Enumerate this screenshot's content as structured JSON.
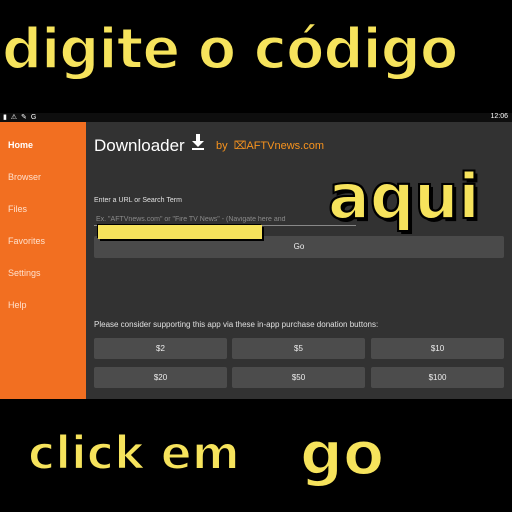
{
  "captions": {
    "top": "digite o código",
    "aqui": "aqui",
    "click": "click em",
    "go": "go"
  },
  "status_bar": {
    "icons": "▮ ⚠ ✎ G",
    "time": "12:06"
  },
  "sidebar": {
    "items": [
      {
        "label": "Home",
        "active": true
      },
      {
        "label": "Browser"
      },
      {
        "label": "Files"
      },
      {
        "label": "Favorites"
      },
      {
        "label": "Settings"
      },
      {
        "label": "Help"
      }
    ]
  },
  "header": {
    "title": "Downloader",
    "by": "by",
    "brand": "AFTVnews.com",
    "icon": "download-icon"
  },
  "url": {
    "label": "Enter a URL or Search Term",
    "placeholder": "Ex. \"AFTVnews.com\" or \"Fire TV News\" - (Navigate here and",
    "go_label": "Go"
  },
  "donation": {
    "message": "Please consider supporting this app via these in-app purchase donation buttons:",
    "buttons": [
      "$2",
      "$5",
      "$10",
      "$20",
      "$50",
      "$100"
    ]
  },
  "colors": {
    "sidebar": "#f26f21",
    "brand": "#f7931e",
    "caption": "#f6e35c",
    "panel": "#323232"
  }
}
